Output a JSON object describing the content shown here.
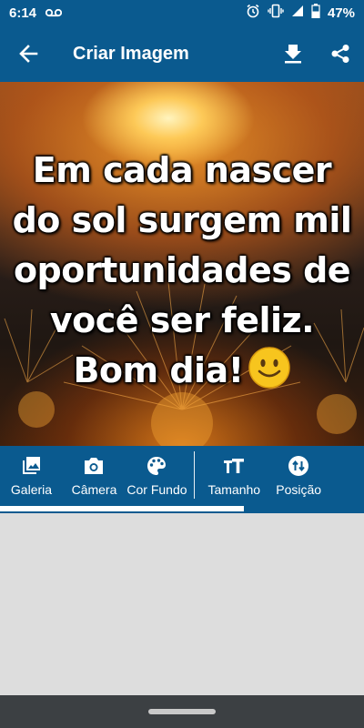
{
  "status_bar": {
    "time": "6:14",
    "battery_percent": "47%"
  },
  "app_bar": {
    "title": "Criar Imagem",
    "icons": [
      "back-arrow-icon",
      "download-icon",
      "share-icon"
    ]
  },
  "canvas": {
    "quote_lines": [
      "Em cada nascer",
      "do sol surgem mil",
      "oportunidades de",
      "você ser feliz.",
      "Bom dia!"
    ],
    "emoji": "smiley-emoji"
  },
  "toolbar": {
    "items": [
      {
        "label": "Galeria",
        "icon": "gallery-icon"
      },
      {
        "label": "Câmera",
        "icon": "camera-icon"
      },
      {
        "label": "Cor Fundo",
        "icon": "palette-icon"
      },
      {
        "label": "Tamanho",
        "icon": "text-size-icon"
      },
      {
        "label": "Posição",
        "icon": "swap-vertical-icon"
      }
    ],
    "scroll_progress": 0.67
  },
  "colors": {
    "primary": "#0a5a8f",
    "background": "#dddddd",
    "nav_bar": "#3c4043"
  }
}
